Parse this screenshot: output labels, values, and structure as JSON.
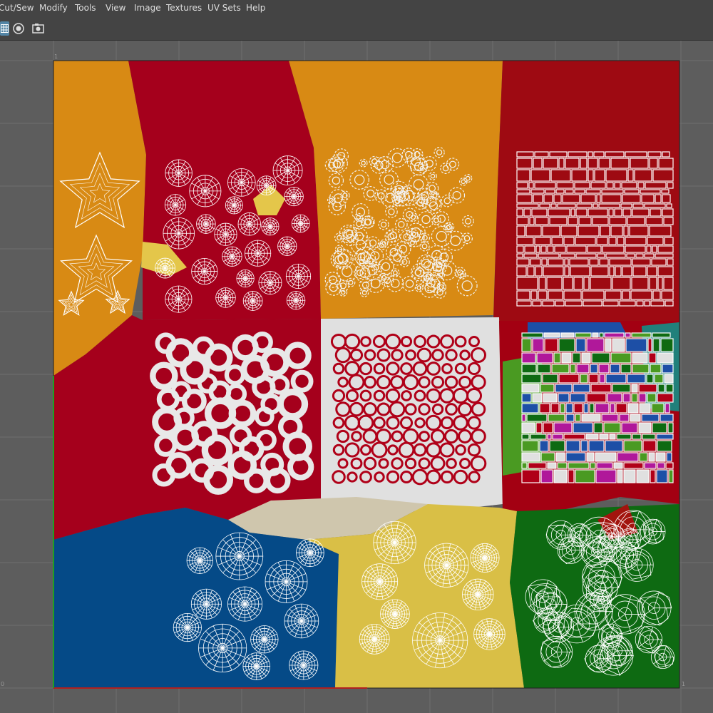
{
  "menu": {
    "items": [
      {
        "key": "cut_sew",
        "label": "Cut/Sew"
      },
      {
        "key": "modify",
        "label": "Modify"
      },
      {
        "key": "tools",
        "label": "Tools"
      },
      {
        "key": "view",
        "label": "View"
      },
      {
        "key": "image",
        "label": "Image"
      },
      {
        "key": "textures",
        "label": "Textures"
      },
      {
        "key": "uv_sets",
        "label": "UV Sets"
      },
      {
        "key": "help",
        "label": "Help"
      }
    ]
  },
  "toolbar": {
    "buttons": [
      {
        "icon": "grid-icon",
        "active": true
      },
      {
        "icon": "shaded-sphere-icon",
        "active": false
      },
      {
        "icon": "camera-icon",
        "active": false
      }
    ]
  },
  "uv_space": {
    "corner_labels": {
      "top_left": "1",
      "bottom_left": "0",
      "bottom_right": "1"
    },
    "colors": {
      "orange": "#d88a14",
      "red": "#a5001c",
      "dark_red": "#9e0a12",
      "blue": "#054a87",
      "yellow": "#d9bf46",
      "green": "#0e6a12",
      "light_grey": "#e0e0e0",
      "beige": "#cfc6ad",
      "wire": "#ffffff",
      "grid": "#6f6f6f",
      "background": "#5d5d5d"
    }
  }
}
